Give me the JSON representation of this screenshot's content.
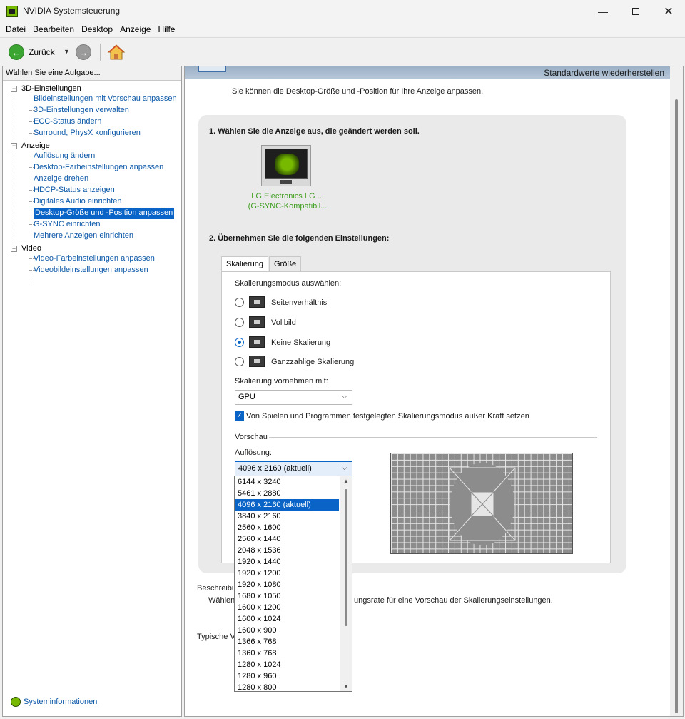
{
  "window": {
    "title": "NVIDIA Systemsteuerung",
    "close_glyph": "✕",
    "minimize_glyph": "—"
  },
  "menu": [
    "Datei",
    "Bearbeiten",
    "Desktop",
    "Anzeige",
    "Hilfe"
  ],
  "toolbar": {
    "back_label": "Zurück",
    "back_glyph": "←",
    "forward_glyph": "→",
    "dropdown_glyph": "▼"
  },
  "left_pane": {
    "header": "Wählen Sie eine Aufgabe...",
    "categories": [
      {
        "label": "3D-Einstellungen",
        "items": [
          "Bildeinstellungen mit Vorschau anpassen",
          "3D-Einstellungen verwalten",
          "ECC-Status ändern",
          "Surround, PhysX konfigurieren"
        ]
      },
      {
        "label": "Anzeige",
        "items": [
          "Auflösung ändern",
          "Desktop-Farbeinstellungen anpassen",
          "Anzeige drehen",
          "HDCP-Status anzeigen",
          "Digitales Audio einrichten",
          "Desktop-Größe und -Position anpassen",
          "G-SYNC einrichten",
          "Mehrere Anzeigen einrichten"
        ]
      },
      {
        "label": "Video",
        "items": [
          "Video-Farbeinstellungen anpassen",
          "Videobildeinstellungen anpassen"
        ]
      }
    ],
    "expander_glyph": "−",
    "selected_item": "Desktop-Größe und -Position anpassen",
    "system_info": "Systeminformationen"
  },
  "main": {
    "restore_defaults": "Standardwerte wiederherstellen",
    "intro": "Sie können die Desktop-Größe und -Position für Ihre Anzeige anpassen.",
    "step1": "1. Wählen Sie die Anzeige aus, die geändert werden soll.",
    "monitor_label_1": "LG Electronics LG ...",
    "monitor_label_2": "(G-SYNC-Kompatibil...",
    "step2": "2. Übernehmen Sie die folgenden Einstellungen:",
    "tabs": [
      "Skalierung",
      "Größe"
    ],
    "scaling_mode_label": "Skalierungsmodus auswählen:",
    "scaling_options": [
      "Seitenverhältnis",
      "Vollbild",
      "Keine Skalierung",
      "Ganzzahlige Skalierung"
    ],
    "selected_scaling": "Keine Skalierung",
    "perform_on_label": "Skalierung vornehmen mit:",
    "perform_on_value": "GPU",
    "override_checkbox": "Von Spielen und Programmen festgelegten Skalierungsmodus außer Kraft setzen",
    "override_checked": true,
    "check_glyph": "✓",
    "combo_arrow": "⌵",
    "preview_label": "Vorschau",
    "resolution_label": "Auflösung:",
    "resolution_value": "4096 x 2160 (aktuell)",
    "description_heading": "Beschreibu",
    "description_prefix": "Wählen",
    "description_suffix": "ungsrate für eine Vorschau der Skalierungseinstellungen.",
    "typical_prefix": "Typische V"
  },
  "resolution_options": [
    "6144 x 3240",
    "5461 x 2880",
    "4096 x 2160 (aktuell)",
    "3840 x 2160",
    "2560 x 1600",
    "2560 x 1440",
    "2048 x 1536",
    "1920 x 1440",
    "1920 x 1200",
    "1920 x 1080",
    "1680 x 1050",
    "1600 x 1200",
    "1600 x 1024",
    "1600 x 900",
    "1366 x 768",
    "1360 x 768",
    "1280 x 1024",
    "1280 x 960",
    "1280 x 800"
  ],
  "dropdown_scroll": {
    "up_glyph": "▲",
    "down_glyph": "▼"
  }
}
